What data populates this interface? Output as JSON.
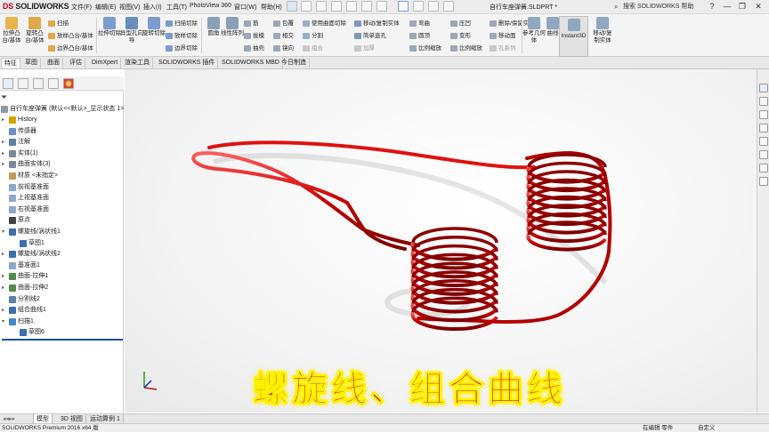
{
  "app": {
    "logo_prefix": "DS",
    "logo_text": "SOLIDWORKS",
    "document_title": "自行车座弹簧.SLDPRT *",
    "help_search": "搜索 SOLIDWORKS 帮助"
  },
  "menus": [
    "文件(F)",
    "编辑(E)",
    "视图(V)",
    "插入(I)",
    "工具(T)",
    "PhotoView 360",
    "窗口(W)",
    "帮助(H)"
  ],
  "window_buttons": [
    "?",
    "—",
    "❐",
    "✕"
  ],
  "ribbon": {
    "big": [
      "拉伸凸台/基体",
      "旋转凸台/基体",
      "拉伸切除",
      "异型孔向导",
      "旋转切除",
      "圆角",
      "线性阵列",
      "参考几何体",
      "曲线",
      "移动/复制实体"
    ],
    "small": [
      "扫描",
      "放样凸台/基体",
      "边界凸台/基体",
      "扫描切除",
      "放样切除",
      "边界切除",
      "筋",
      "拔模",
      "抽壳",
      "包覆",
      "相交",
      "镜向",
      "使用曲面切除",
      "分割",
      "组合",
      "移动/复制实体",
      "简单直孔",
      "加厚",
      "弯曲",
      "圆顶",
      "比例缩放",
      "压凹",
      "变形",
      "比例缩放",
      "删除/保留实体",
      "移动面",
      "孔系列"
    ],
    "instant3d": "Instant3D"
  },
  "command_tabs": [
    {
      "label": "特征",
      "active": true
    },
    {
      "label": "草图"
    },
    {
      "label": "曲面"
    },
    {
      "label": "评估"
    },
    {
      "label": "DimXpert"
    },
    {
      "label": "渲染工具"
    },
    {
      "label": "SOLIDWORKS 插件"
    },
    {
      "label": "SOLIDWORKS MBD"
    },
    {
      "label": "今日制造"
    }
  ],
  "tree": {
    "root": "自行车座弹簧 (默认<<默认>_显示状态 1>)",
    "items": [
      {
        "label": "History",
        "color": "#d9a300",
        "arrow": "▸"
      },
      {
        "label": "传感器",
        "color": "#6a8fbf"
      },
      {
        "label": "注解",
        "color": "#5a7fa8",
        "arrow": "▸"
      },
      {
        "label": "实体(1)",
        "color": "#7a8a9a",
        "arrow": "▸"
      },
      {
        "label": "曲面实体(3)",
        "color": "#7a8a9a",
        "arrow": "▸"
      },
      {
        "label": "材质 <未指定>",
        "color": "#c29a5a"
      },
      {
        "label": "前视基准面",
        "color": "#8aa8c8"
      },
      {
        "label": "上视基准面",
        "color": "#8aa8c8"
      },
      {
        "label": "右视基准面",
        "color": "#8aa8c8"
      },
      {
        "label": "原点",
        "color": "#444"
      },
      {
        "label": "螺旋线/涡状线1",
        "color": "#3a6fb0",
        "arrow": "▾"
      },
      {
        "label": "草图1",
        "color": "#3a6fb0",
        "indent": true
      },
      {
        "label": "螺旋线/涡状线2",
        "color": "#3a6fb0",
        "arrow": "▸"
      },
      {
        "label": "基准面1",
        "color": "#8aa8c8"
      },
      {
        "label": "曲面-拉伸1",
        "color": "#4f8a4f",
        "arrow": "▸"
      },
      {
        "label": "曲面-拉伸2",
        "color": "#4f8a4f",
        "arrow": "▸"
      },
      {
        "label": "分割线2",
        "color": "#5a7fa8"
      },
      {
        "label": "组合曲线1",
        "color": "#3a6fb0",
        "arrow": "▸"
      },
      {
        "label": "扫描1",
        "color": "#3a8ac8",
        "arrow": "▾"
      },
      {
        "label": "草图6",
        "color": "#3a6fb0",
        "indent": true
      }
    ]
  },
  "bottom_tabs": [
    {
      "label": "模型",
      "active": true
    },
    {
      "label": "3D 视图"
    },
    {
      "label": "运动算例 1"
    }
  ],
  "status": {
    "product": "SOLIDWORKS Premium 2016 x64 版",
    "mode": "在编辑 零件",
    "units": "自定义"
  },
  "caption": "螺旋线、组合曲线",
  "colors": {
    "spring": "#d00000",
    "caption": "#d40000",
    "caption_stroke": "#fff200"
  }
}
